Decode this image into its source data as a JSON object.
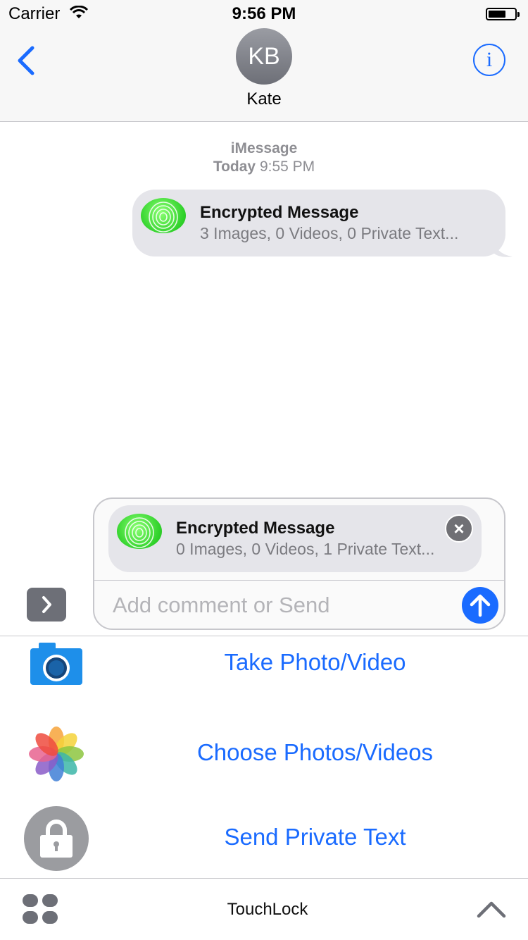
{
  "status_bar": {
    "carrier": "Carrier",
    "time": "9:56 PM"
  },
  "nav": {
    "avatar_initials": "KB",
    "contact_name": "Kate",
    "info_icon": "i"
  },
  "conversation": {
    "service": "iMessage",
    "timestamp_day": "Today",
    "timestamp_time": "9:55 PM",
    "message": {
      "title": "Encrypted Message",
      "subtitle": "3 Images, 0 Videos, 0 Private Text..."
    }
  },
  "compose": {
    "attachment_title": "Encrypted Message",
    "attachment_subtitle": "0 Images, 0 Videos, 1 Private Text...",
    "placeholder": "Add comment or Send"
  },
  "app_panel": {
    "actions": [
      {
        "label": "Take Photo/Video",
        "icon": "camera-icon"
      },
      {
        "label": "Choose Photos/Videos",
        "icon": "photos-icon"
      },
      {
        "label": "Send Private Text",
        "icon": "lock-icon"
      }
    ],
    "app_name": "TouchLock"
  },
  "colors": {
    "accent": "#1a6bff",
    "fingerprint_green": "#3ddc33",
    "bubble_gray": "#e5e5ea"
  }
}
